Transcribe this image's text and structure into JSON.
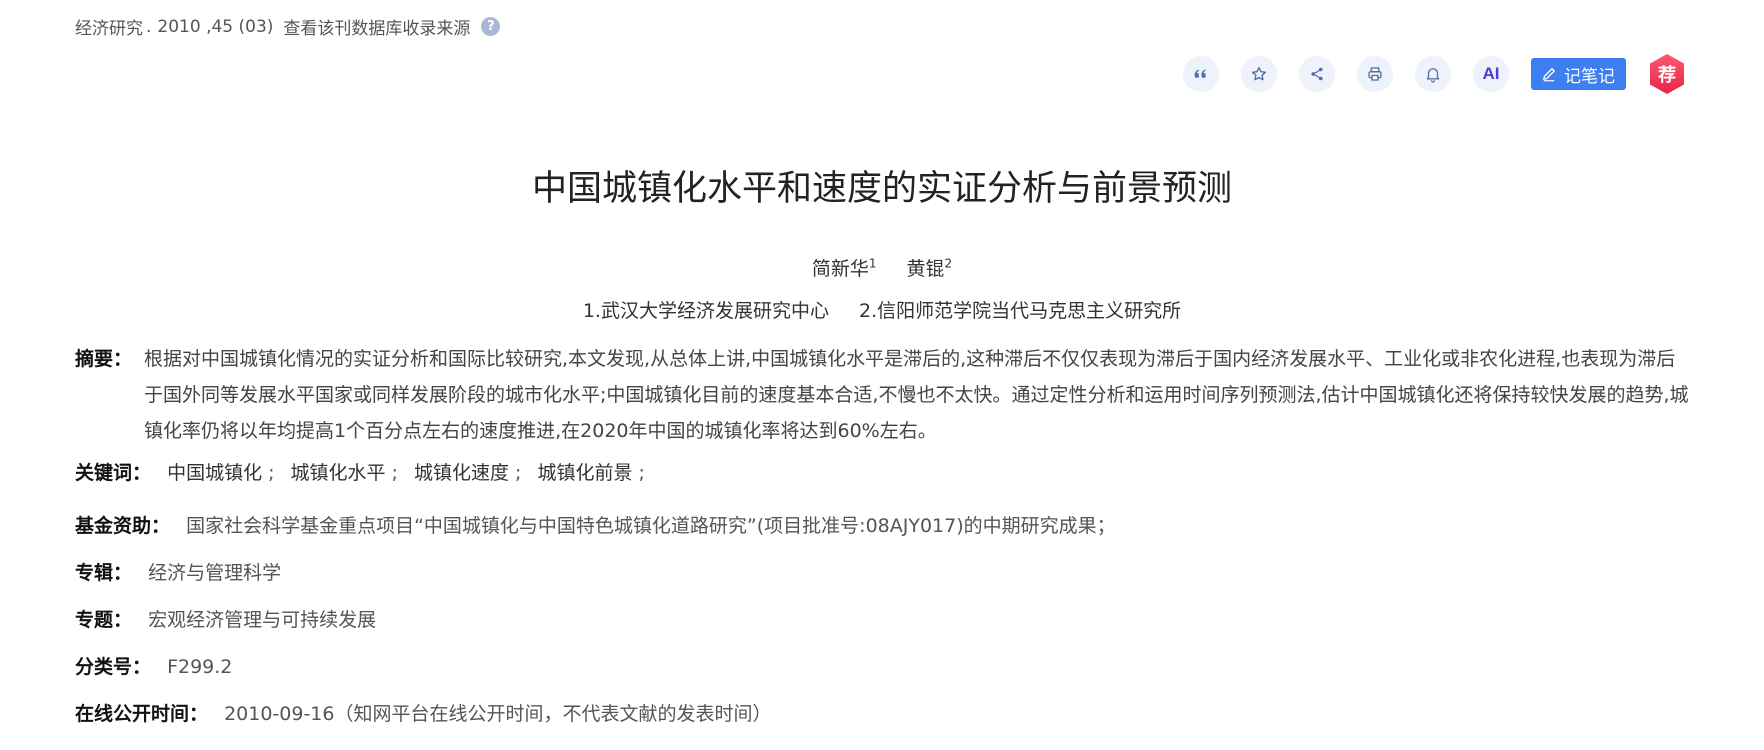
{
  "source": {
    "journal": "经济研究",
    "sep": ".",
    "issue": "2010 ,45 (03)",
    "db_link": "查看该刊数据库收录来源",
    "help": "?"
  },
  "toolbar": {
    "note_label": "记笔记",
    "ai_label": "AI",
    "recommend_label": "荐"
  },
  "article": {
    "title": "中国城镇化水平和速度的实证分析与前景预测",
    "authors": [
      {
        "name": "简新华",
        "sup": "1"
      },
      {
        "name": "黄锟",
        "sup": "2"
      }
    ],
    "orgs": [
      "1.武汉大学经济发展研究中心",
      "2.信阳师范学院当代马克思主义研究所"
    ]
  },
  "fields": {
    "abstract_label": "摘要：",
    "abstract": "根据对中国城镇化情况的实证分析和国际比较研究,本文发现,从总体上讲,中国城镇化水平是滞后的,这种滞后不仅仅表现为滞后于国内经济发展水平、工业化或非农化进程,也表现为滞后于国外同等发展水平国家或同样发展阶段的城市化水平;中国城镇化目前的速度基本合适,不慢也不太快。通过定性分析和运用时间序列预测法,估计中国城镇化还将保持较快发展的趋势,城镇化率仍将以年均提高1个百分点左右的速度推进,在2020年中国的城镇化率将达到60%左右。",
    "keywords_label": "关键词：",
    "keywords": [
      "中国城镇化",
      "城镇化水平",
      "城镇化速度",
      "城镇化前景"
    ],
    "keyword_sep": ";",
    "fund_label": "基金资助：",
    "fund": "国家社会科学基金重点项目“中国城镇化与中国特色城镇化道路研究”(项目批准号:08AJY017)的中期研究成果；",
    "album_label": "专辑：",
    "album": "经济与管理科学",
    "topic_label": "专题：",
    "topic": "宏观经济管理与可持续发展",
    "class_label": "分类号：",
    "class_no": "F299.2",
    "online_label": "在线公开时间：",
    "online_time": "2010-09-16（知网平台在线公开时间，不代表文献的发表时间）"
  }
}
